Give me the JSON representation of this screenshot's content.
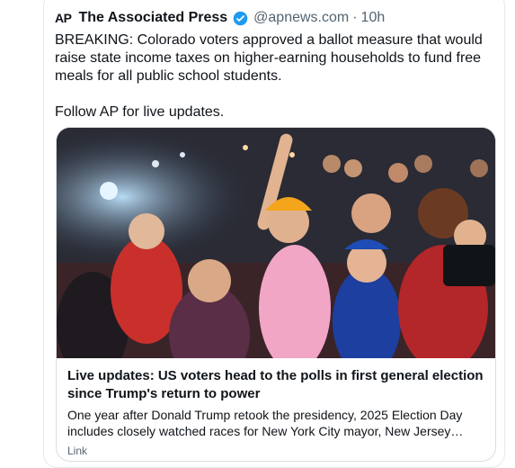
{
  "tweet": {
    "logo": "AP",
    "name": "The Associated Press",
    "handle": "@apnews.com",
    "separator": "·",
    "time": "10h",
    "text": "BREAKING: Colorado voters approved a ballot measure that would raise state income taxes on higher-earning households to fund free meals for all public school students.",
    "follow": "Follow AP for live updates.",
    "colors": {
      "verified": "#1d9bf0",
      "secondary": "#536471"
    }
  },
  "card": {
    "image_icon": "crowd-celebration-photo",
    "title": "Live updates: US voters head to the polls in first general election since Trump's return to power",
    "description": "One year after Donald Trump retook the presidency, 2025 Election Day includes closely watched races for New York City mayor, New Jersey governor and more.",
    "source": "Link"
  }
}
